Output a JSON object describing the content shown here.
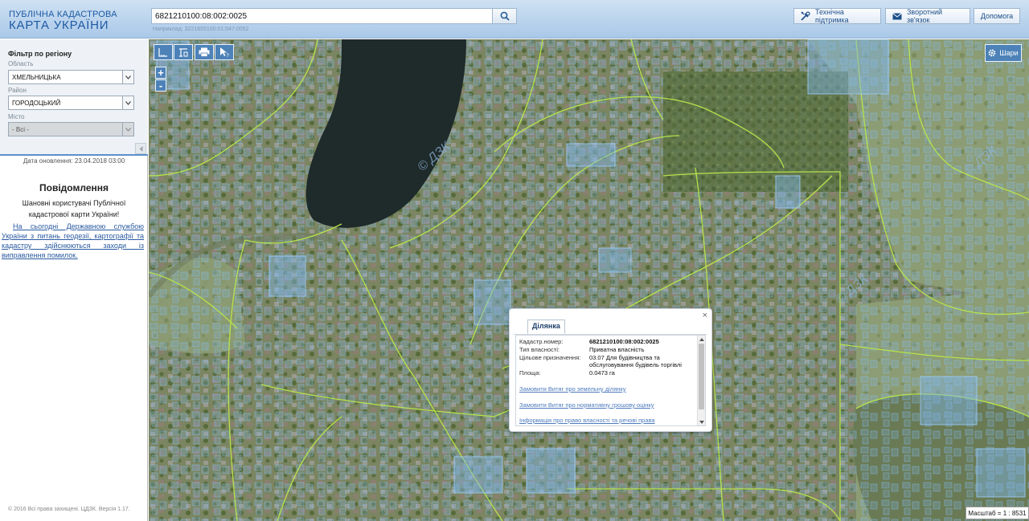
{
  "header": {
    "logo_line1": "ПУБЛІЧНА КАДАСТРОВА",
    "logo_line2": "КАРТА УКРАЇНИ",
    "search_value": "6821210100:08:002:0025",
    "search_hint": "Наприклад: 3221655100:01:047:0052",
    "btn_support": "Технічна підтримка",
    "btn_feedback": "Зворотний зв'язок",
    "btn_help": "Допомога"
  },
  "sidebar": {
    "filter_title": "Фільтр по регіону",
    "region_label": "Область",
    "region_value": "ХМЕЛЬНИЦЬКА",
    "district_label": "Район",
    "district_value": "ГОРОДОЦЬКИЙ",
    "city_label": "Місто",
    "city_value": "- Всі -",
    "update_date": "Дата оновлення: 23.04.2018 03:00",
    "notice_title": "Повідомлення",
    "notice_greeting": "Шановні користувачі Публічної кадастрової карти України!",
    "notice_link": "На сьогодні Державною службою України з питань геодезії, картографії та кадастру здійснюються заходи із виправлення помилок.",
    "copyright": "© 2016 Всі права захищені. ЦДЗК. Версія 1.17."
  },
  "map": {
    "layers_label": "Шари",
    "scale_text": "Масштаб = 1 : 8531",
    "watermark": "© ДЗК",
    "zoom_in": "+",
    "zoom_out": "-"
  },
  "popup": {
    "tab_label": "Ділянка",
    "close_symbol": "×",
    "cadastral_label": "Кадастр.номер:",
    "cadastral_value": "6821210100:08:002:0025",
    "ownership_label": "Тип власності:",
    "ownership_value": "Приватна власність",
    "purpose_label": "Цільове призначення:",
    "purpose_value": "03.07 Для будівництва та обслуговування будівель торгівлі",
    "area_label": "Площа:",
    "area_value": "0.0473 га",
    "link_extract": "Замовити Витяг про земельну ділянку",
    "link_valuation": "Замовити Витяг про нормативну грошову оцінку",
    "link_rights": "Інформація про право власності та речові права"
  },
  "colors": {
    "accent": "#4d82b8",
    "parcel_fill": "#7fb6ea",
    "road_line": "#b6e34a",
    "water": "#1f2a2a"
  }
}
